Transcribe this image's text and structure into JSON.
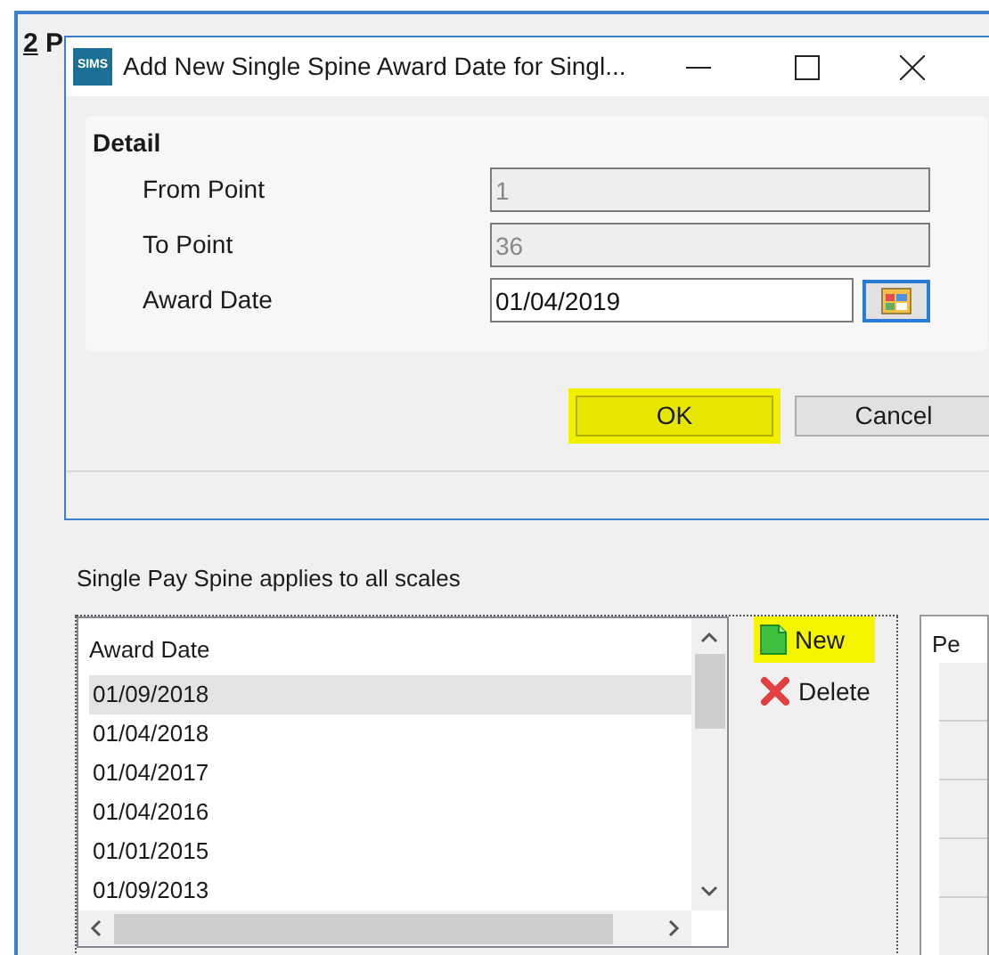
{
  "background_window": {
    "title": "2 P",
    "title_access_key_underlined": true,
    "caption": "Single Pay Spine applies to all scales",
    "list": {
      "column": "Award Date",
      "rows": [
        {
          "text": "01/09/2018",
          "selected": true
        },
        {
          "text": "01/04/2018",
          "selected": false
        },
        {
          "text": "01/04/2017",
          "selected": false
        },
        {
          "text": "01/04/2016",
          "selected": false
        },
        {
          "text": "01/01/2015",
          "selected": false
        },
        {
          "text": "01/09/2013",
          "selected": false
        }
      ]
    },
    "actions": [
      {
        "kind": "new",
        "label": "New",
        "highlighted": true
      },
      {
        "kind": "delete",
        "label": "Delete",
        "highlighted": false
      }
    ],
    "side_grid": {
      "column": "Pe"
    }
  },
  "dialog": {
    "app_icon_text": "SIMS",
    "title": "Add New Single Spine Award Date for Singl...",
    "group": {
      "title": "Detail",
      "fields": [
        {
          "label": "From Point",
          "value": "1",
          "disabled": true,
          "kind": "text"
        },
        {
          "label": "To Point",
          "value": "36",
          "disabled": true,
          "kind": "text"
        },
        {
          "label": "Award Date",
          "value": "01/04/2019",
          "disabled": false,
          "kind": "date"
        }
      ]
    },
    "buttons": [
      {
        "label": "OK",
        "highlighted": true
      },
      {
        "label": "Cancel",
        "highlighted": false
      }
    ]
  }
}
